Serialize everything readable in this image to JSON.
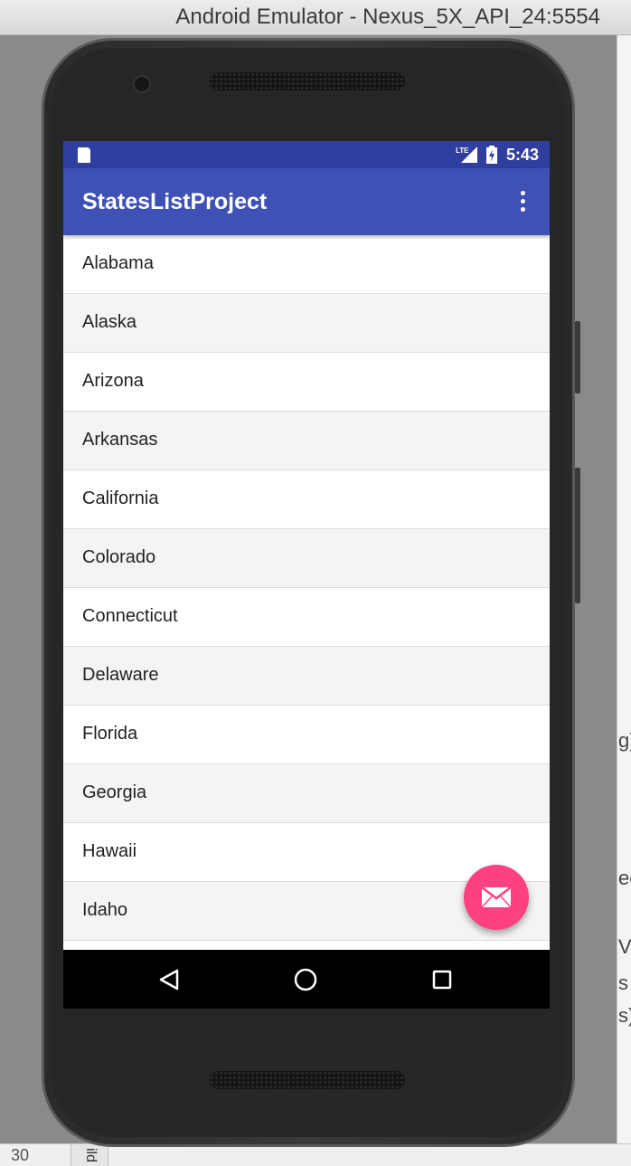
{
  "window": {
    "title": "Android Emulator - Nexus_5X_API_24:5554"
  },
  "status_bar": {
    "time": "5:43",
    "signal_label": "LTE",
    "icons": [
      "sd-card-icon",
      "lte-signal-icon",
      "battery-charging-icon"
    ]
  },
  "app_bar": {
    "title": "StatesListProject",
    "overflow_icon": "more-vert-icon"
  },
  "states": [
    "Alabama",
    "Alaska",
    "Arizona",
    "Arkansas",
    "California",
    "Colorado",
    "Connecticut",
    "Delaware",
    "Florida",
    "Georgia",
    "Hawaii",
    "Idaho"
  ],
  "fab": {
    "icon": "email-icon"
  },
  "nav_bar": {
    "icons": [
      "back-icon",
      "home-icon",
      "recents-icon"
    ]
  },
  "ide_fragments": {
    "right": [
      "g)",
      "ec",
      "Ve",
      "s",
      "s)"
    ],
    "bottom_line_number": "30",
    "bottom_tab": "ild"
  },
  "colors": {
    "status_bar": "#303f9f",
    "primary": "#3f51b5",
    "accent": "#ff4081"
  }
}
